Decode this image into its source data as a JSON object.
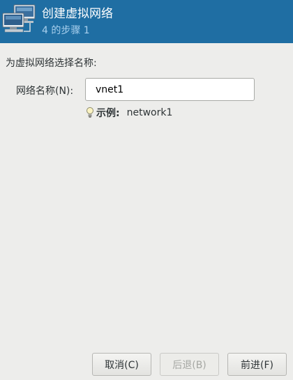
{
  "header": {
    "title": "创建虚拟网络",
    "subtitle": "4 的步骤 1",
    "icon": "network-computers-icon"
  },
  "form": {
    "section_label": "为虚拟网络选择名称:",
    "name_label": "网络名称(N):",
    "name_value": "vnet1",
    "hint_icon": "lightbulb-icon",
    "hint_label": "示例:",
    "hint_value": "network1"
  },
  "buttons": {
    "cancel": "取消(C)",
    "back": "后退(B)",
    "forward": "前进(F)"
  },
  "colors": {
    "header_bg": "#1f6ea3",
    "window_bg": "#ededeb"
  }
}
